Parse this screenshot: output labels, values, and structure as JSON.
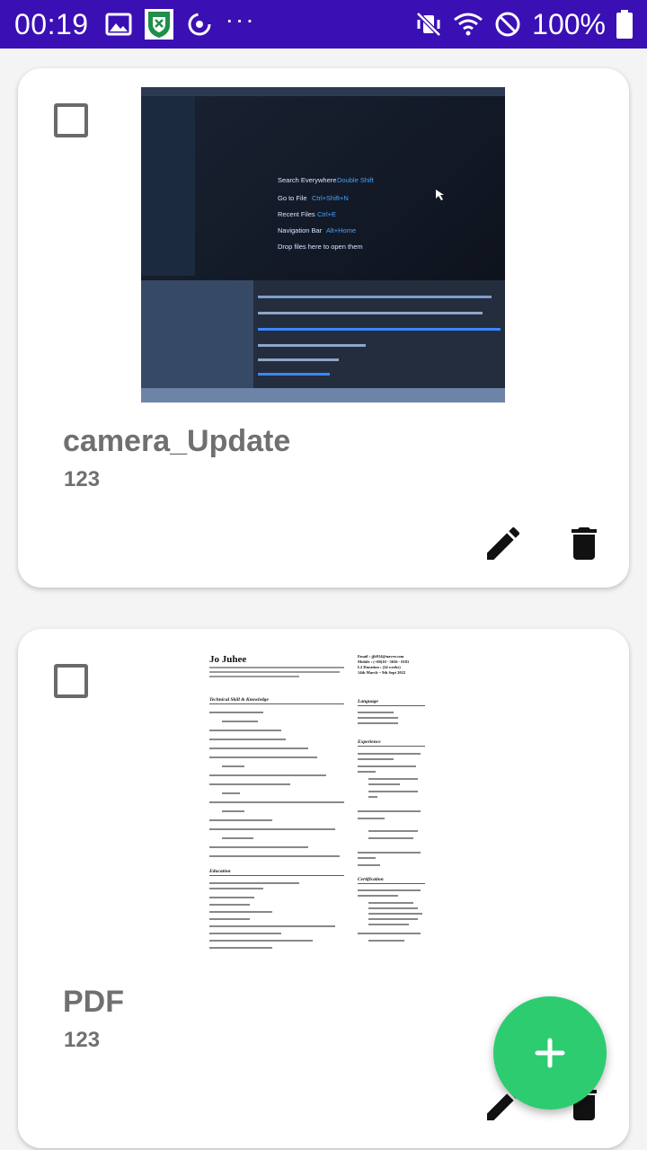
{
  "status_bar": {
    "time": "00:19",
    "battery": "100%",
    "more": "···"
  },
  "documents": [
    {
      "title": "camera_Update",
      "subtitle": "123",
      "preview_lines": [
        {
          "label": "Search Everywhere",
          "key": "Double Shift"
        },
        {
          "label": "Go to File",
          "key": "Ctrl+Shift+N"
        },
        {
          "label": "Recent Files",
          "key": "Ctrl+E"
        },
        {
          "label": "Navigation Bar",
          "key": "Alt+Home"
        },
        {
          "label": "Drop files here to open them",
          "key": ""
        }
      ]
    },
    {
      "title": "PDF",
      "subtitle": "123",
      "preview_name": "Jo Juhee",
      "preview_contact": [
        "Email : jjh914@naver.com",
        "Mobile : (+60)10 - 3656 - 0181",
        "L2 Duration : (24 weeks)",
        "14th March ~ 9th Sept 2022"
      ],
      "preview_sections": [
        "Technical Skill & Knowledge",
        "Language",
        "Experience",
        "Education",
        "Certification"
      ]
    }
  ],
  "colors": {
    "status_bar": "#3a10b5",
    "fab": "#2ecc71",
    "text_gray": "#707070"
  }
}
